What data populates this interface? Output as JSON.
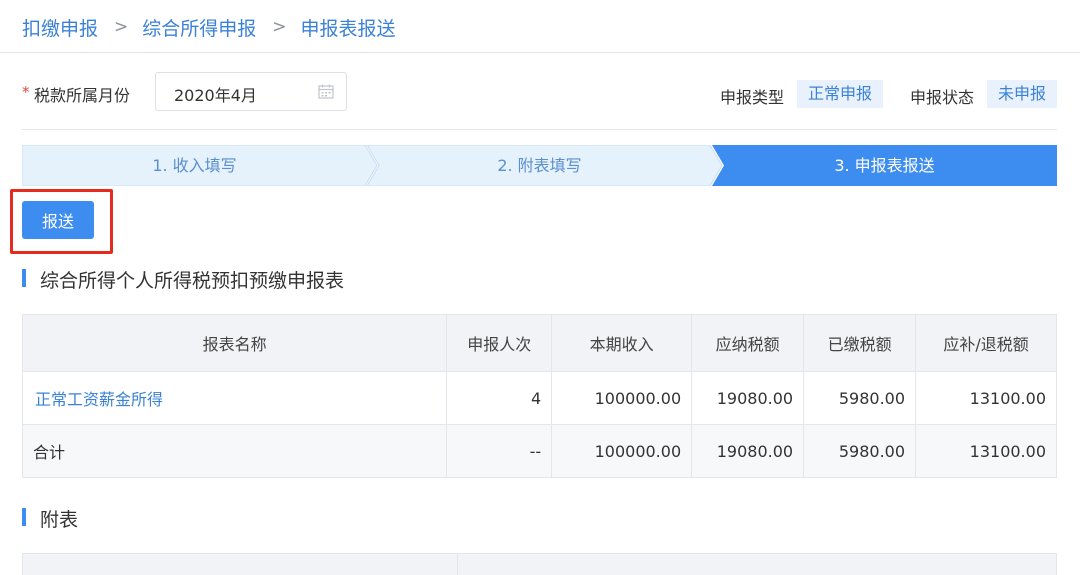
{
  "breadcrumb": {
    "items": [
      "扣缴申报",
      "综合所得申报",
      "申报表报送"
    ],
    "separator": ">"
  },
  "header": {
    "month_label": "税款所属月份",
    "month_value": "2020年4月",
    "type_label": "申报类型",
    "type_value": "正常申报",
    "status_label": "申报状态",
    "status_value": "未申报"
  },
  "steps": [
    {
      "label": "1. 收入填写",
      "active": false
    },
    {
      "label": "2. 附表填写",
      "active": false
    },
    {
      "label": "3. 申报表报送",
      "active": true
    }
  ],
  "actions": {
    "submit_label": "报送"
  },
  "main_section": {
    "title": "综合所得个人所得税预扣预缴申报表",
    "columns": [
      "报表名称",
      "申报人次",
      "本期收入",
      "应纳税额",
      "已缴税额",
      "应补/退税额"
    ],
    "rows": [
      {
        "name": "正常工资薪金所得",
        "count": "4",
        "income": "100000.00",
        "tax_payable": "19080.00",
        "tax_paid": "5980.00",
        "tax_due": "13100.00"
      }
    ],
    "total": {
      "name": "合计",
      "count": "--",
      "income": "100000.00",
      "tax_payable": "19080.00",
      "tax_paid": "5980.00",
      "tax_due": "13100.00"
    }
  },
  "attach_section": {
    "title": "附表"
  },
  "colors": {
    "accent": "#3d8df0",
    "link": "#3b82d6",
    "highlight_box": "#e52a1f",
    "step_inactive_bg": "#e5f1fb",
    "step_active_bg": "#3d8df0"
  },
  "icons": {
    "month_picker": "calendar-icon",
    "breadcrumb_separator": "chevron-right-icon"
  }
}
